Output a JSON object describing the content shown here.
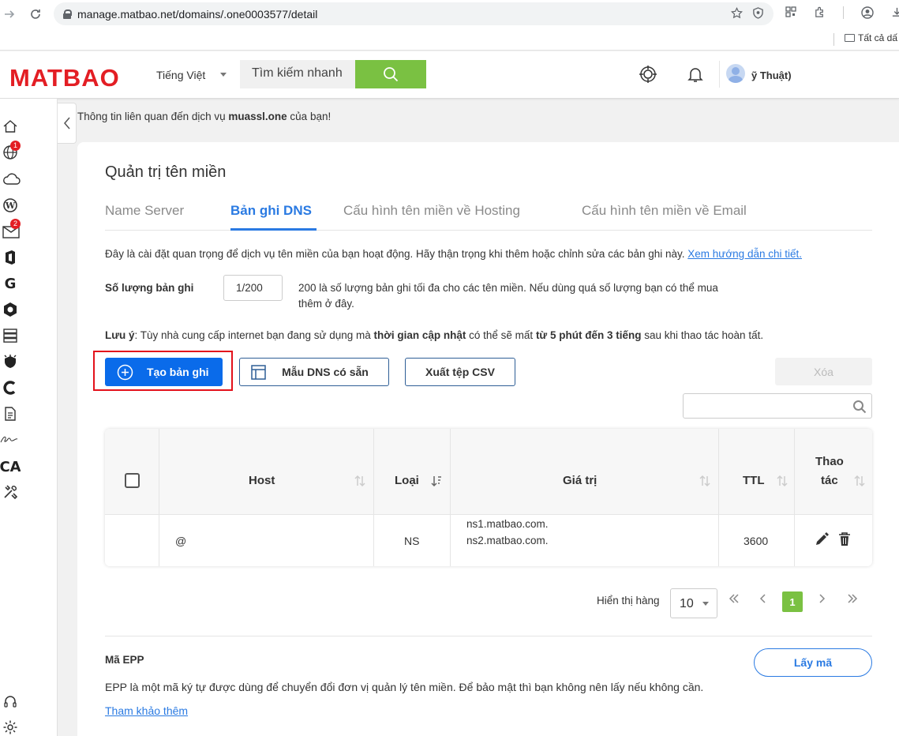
{
  "browser": {
    "url": "manage.matbao.net/domains/.one0003577/detail",
    "bookmarks_all": "Tất cả dấ"
  },
  "header": {
    "logo_text": "MATBAO",
    "language": "Tiếng Việt",
    "search_placeholder": "Tìm kiếm nhanh",
    "user_name": "ỹ Thuật)"
  },
  "sidebar": {
    "badge_domains": "1",
    "badge_mail": "2"
  },
  "notice": {
    "prefix": "Thông tin liên quan đến dịch vụ ",
    "domain": "muassl.one",
    "suffix": " của bạn!"
  },
  "main": {
    "title": "Quản trị tên miền",
    "tabs": [
      {
        "label": "Name Server",
        "active": false
      },
      {
        "label": "Bản ghi DNS",
        "active": true
      },
      {
        "label": "Cấu hình tên miền về Hosting",
        "active": false
      },
      {
        "label": "Cấu hình tên miền về Email",
        "active": false
      }
    ],
    "intro_text": "Đây là cài đặt quan trọng để dịch vụ tên miền của bạn hoạt động. Hãy thận trọng khi thêm hoặc chỉnh sửa các bản ghi này. ",
    "intro_link": "Xem hướng dẫn chi tiết.",
    "count_label": "Số lượng bản ghi",
    "count_value": "1/200",
    "count_desc": "200 là số lượng bản ghi tối đa cho các tên miền. Nếu dùng quá số lượng bạn có thể mua thêm ở đây.",
    "note_prefix": "Lưu ý",
    "note_part1": ": Tùy nhà cung cấp internet bạn đang sử dụng mà ",
    "note_bold1": "thời gian cập nhật",
    "note_part2": " có thể sẽ mất ",
    "note_bold2": "từ 5 phút đến 3 tiếng",
    "note_part3": " sau khi thao tác hoàn tất.",
    "buttons": {
      "create": "Tạo bản ghi",
      "template": "Mẫu DNS có sẵn",
      "export": "Xuất tệp CSV",
      "delete": "Xóa"
    }
  },
  "table": {
    "columns": [
      "Host",
      "Loại",
      "Giá trị",
      "TTL",
      "Thao",
      "tác"
    ],
    "rows": [
      {
        "host": "@",
        "type": "NS",
        "value_1": "ns1.matbao.com.",
        "value_2": "ns2.matbao.com.",
        "ttl": "3600"
      }
    ]
  },
  "pagination": {
    "label": "Hiển thị hàng",
    "page_size": "10",
    "current_page": "1"
  },
  "epp": {
    "title": "Mã EPP",
    "desc": "EPP là một mã ký tự được dùng để chuyển đổi đơn vị quản lý tên miền. Để bảo mật thì bạn không nên lấy nếu không cần. ",
    "link": "Tham khảo thêm",
    "button": "Lấy mã"
  },
  "colors": {
    "brand_red": "#e31e24",
    "primary_blue": "#0a6bea",
    "accent_green": "#7ac142",
    "highlight_red": "#e3111b"
  }
}
